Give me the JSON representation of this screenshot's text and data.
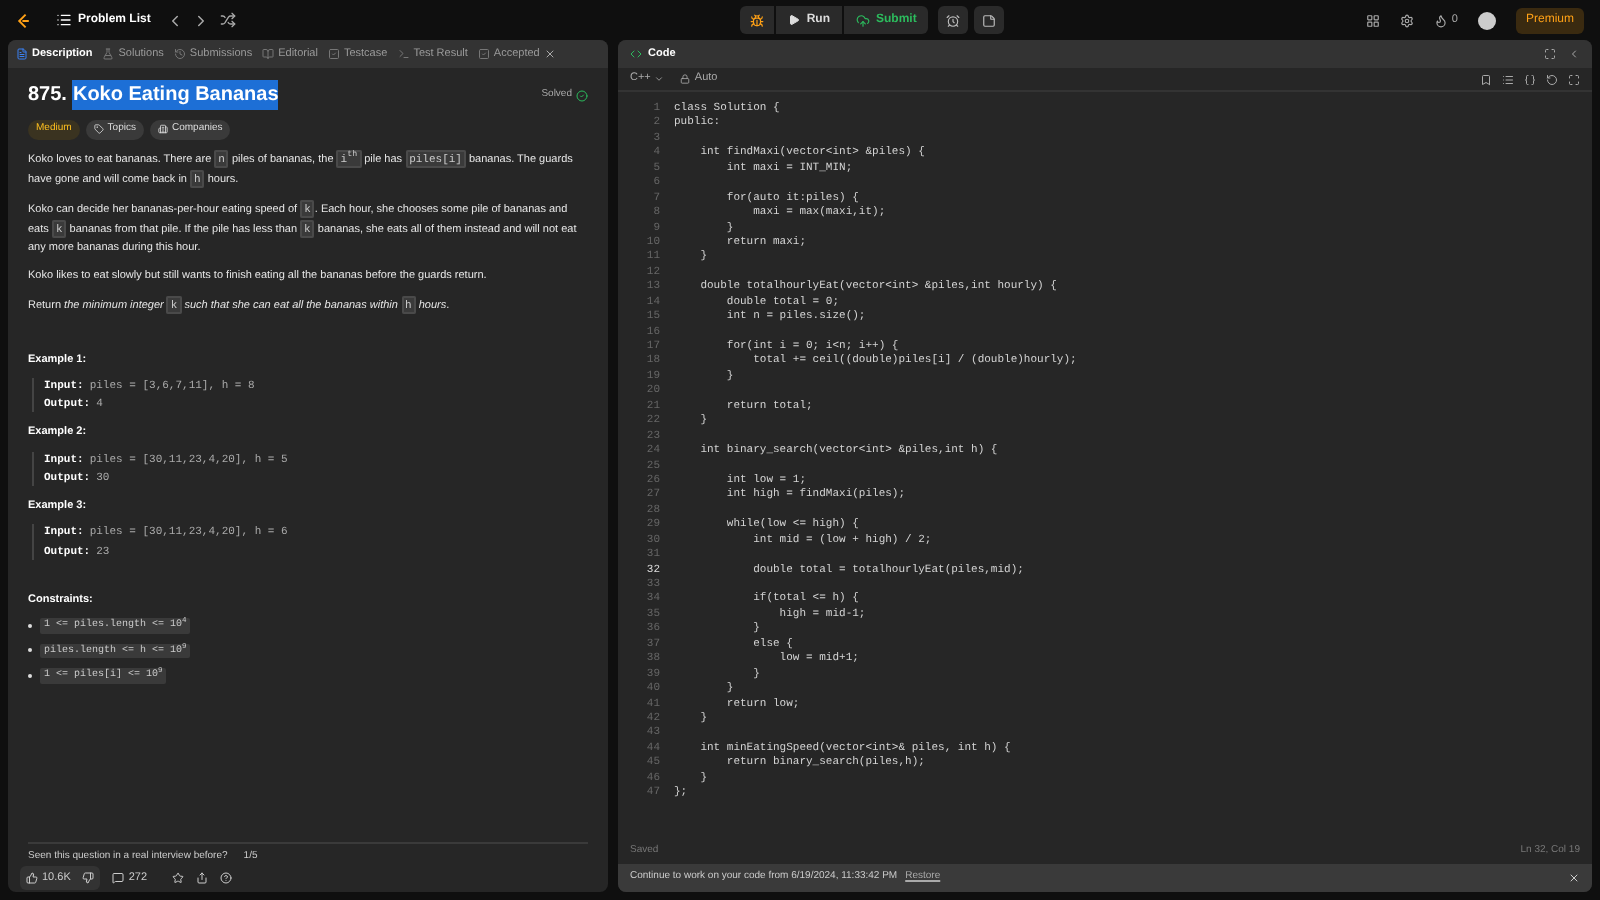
{
  "top_bar": {
    "problem_list": "Problem List",
    "run": "Run",
    "submit": "Submit",
    "streak": "0",
    "premium": "Premium"
  },
  "left_tabs": [
    {
      "label": "Description",
      "selected": true
    },
    {
      "label": "Solutions",
      "selected": false
    },
    {
      "label": "Submissions",
      "selected": false
    },
    {
      "label": "Editorial",
      "selected": false
    },
    {
      "label": "Testcase",
      "selected": false
    },
    {
      "label": "Test Result",
      "selected": false
    },
    {
      "label": "Accepted",
      "selected": false,
      "closable": true
    }
  ],
  "problem": {
    "number": "875.",
    "title": "Koko Eating Bananas",
    "title_selected": true,
    "status": "Solved",
    "tags": [
      {
        "label": "Medium",
        "kind": "difficulty"
      },
      {
        "label": "Topics",
        "kind": "topics"
      },
      {
        "label": "Companies",
        "kind": "companies"
      }
    ],
    "paragraphs": [
      [
        {
          "kind": "text",
          "text": "Koko loves to eat bananas. There are "
        },
        {
          "kind": "code",
          "text": "n"
        },
        {
          "kind": "text",
          "text": " piles of bananas, the "
        },
        {
          "kind": "code",
          "text": "i$^{th}$"
        },
        {
          "kind": "text",
          "text": " pile has "
        },
        {
          "kind": "code",
          "text": "piles[i]"
        },
        {
          "kind": "text",
          "text": " bananas. The guards have gone and will come back in "
        },
        {
          "kind": "code",
          "text": "h"
        },
        {
          "kind": "text",
          "text": " hours."
        }
      ],
      [
        {
          "kind": "text",
          "text": "Koko can decide her bananas-per-hour eating speed of "
        },
        {
          "kind": "code",
          "text": "k"
        },
        {
          "kind": "text",
          "text": ". Each hour, she chooses some pile of bananas and eats "
        },
        {
          "kind": "code",
          "text": "k"
        },
        {
          "kind": "text",
          "text": " bananas from that pile. If the pile has less than "
        },
        {
          "kind": "code",
          "text": "k"
        },
        {
          "kind": "text",
          "text": " bananas, she eats all of them instead and will not eat any more bananas during this hour."
        }
      ],
      [
        {
          "kind": "text",
          "text": "Koko likes to eat slowly but still wants to finish eating all the bananas before the guards return."
        }
      ],
      [
        {
          "kind": "text",
          "text": "Return *the minimum integer* "
        },
        {
          "kind": "code",
          "text": "k"
        },
        {
          "kind": "text",
          "text": " *such that she can eat all the bananas within* "
        },
        {
          "kind": "code",
          "text": "h"
        },
        {
          "kind": "text",
          "text": " *hours*."
        }
      ]
    ],
    "examples": [
      {
        "title": "Example 1:",
        "input_label": "Input:",
        "input": "piles = [3,6,7,11], h = 8",
        "output_label": "Output:",
        "output": "4"
      },
      {
        "title": "Example 2:",
        "input_label": "Input:",
        "input": "piles = [30,11,23,4,20], h = 5",
        "output_label": "Output:",
        "output": "30"
      },
      {
        "title": "Example 3:",
        "input_label": "Input:",
        "input": "piles = [30,11,23,4,20], h = 6",
        "output_label": "Output:",
        "output": "23"
      }
    ],
    "constraints_title": "Constraints:",
    "constraints": [
      "1 <= piles.length <= 10$^{4}$",
      "piles.length <= h <= 10$^{9}$",
      "1 <= piles[i] <= 10$^{9}$"
    ],
    "interview_question": "Seen this question in a real interview before?",
    "interview_count": "1/5",
    "likes": "10.6K",
    "comments": "272"
  },
  "code_panel": {
    "title": "Code",
    "language": "C++",
    "mode": "Auto",
    "lines": [
      {
        "n": "1",
        "text": "class Solution {"
      },
      {
        "n": "2",
        "text": "public:"
      },
      {
        "n": "3"
      },
      {
        "n": "4",
        "text": "    int findMaxi(vector<int> &piles) {"
      },
      {
        "n": "5",
        "text": "        int maxi = INT_MIN;"
      },
      {
        "n": "6"
      },
      {
        "n": "7",
        "text": "        for(auto it:piles) {"
      },
      {
        "n": "8",
        "text": "            maxi = max(maxi,it);"
      },
      {
        "n": "9",
        "text": "        }"
      },
      {
        "n": "10",
        "text": "        return maxi;"
      },
      {
        "n": "11",
        "text": "    }"
      },
      {
        "n": "12"
      },
      {
        "n": "13",
        "text": "    double totalhourlyEat(vector<int> &piles,int hourly) {"
      },
      {
        "n": "14",
        "text": "        double total = 0;"
      },
      {
        "n": "15",
        "text": "        int n = piles.size();"
      },
      {
        "n": "16"
      },
      {
        "n": "17",
        "text": "        for(int i = 0; i<n; i++) {"
      },
      {
        "n": "18",
        "text": "            total += ceil((double)piles[i] / (double)hourly);"
      },
      {
        "n": "19",
        "text": "        }"
      },
      {
        "n": "20"
      },
      {
        "n": "21",
        "text": "        return total;"
      },
      {
        "n": "22",
        "text": "    }"
      },
      {
        "n": "23"
      },
      {
        "n": "24",
        "text": "    int binary_search(vector<int> &piles,int h) {"
      },
      {
        "n": "25"
      },
      {
        "n": "26",
        "text": "        int low = 1;"
      },
      {
        "n": "27",
        "text": "        int high = findMaxi(piles);"
      },
      {
        "n": "28"
      },
      {
        "n": "29",
        "text": "        while(low <= high) {"
      },
      {
        "n": "30",
        "text": "            int mid = (low + high) / 2;"
      },
      {
        "n": "31"
      },
      {
        "n": "32",
        "text": "            double total = totalhourlyEat(piles,mid);",
        "current": true
      },
      {
        "n": "33"
      },
      {
        "n": "34",
        "text": "            if(total <= h) {"
      },
      {
        "n": "35",
        "text": "                high = mid-1;"
      },
      {
        "n": "36",
        "text": "            }"
      },
      {
        "n": "37",
        "text": "            else {"
      },
      {
        "n": "38",
        "text": "                low = mid+1;"
      },
      {
        "n": "39",
        "text": "            }"
      },
      {
        "n": "40",
        "text": "        }"
      },
      {
        "n": "41",
        "text": "        return low;"
      },
      {
        "n": "42",
        "text": "    }"
      },
      {
        "n": "43"
      },
      {
        "n": "44",
        "text": "    int minEatingSpeed(vector<int>& piles, int h) {"
      },
      {
        "n": "45",
        "text": "        return binary_search(piles,h);"
      },
      {
        "n": "46",
        "text": "    }"
      },
      {
        "n": "47",
        "text": "};"
      }
    ],
    "saved": "Saved",
    "cursor": "Ln 32, Col 19",
    "banner": {
      "text": "Continue to work on your code from 6/19/2024, 11:33:42 PM",
      "action": "Restore"
    }
  }
}
